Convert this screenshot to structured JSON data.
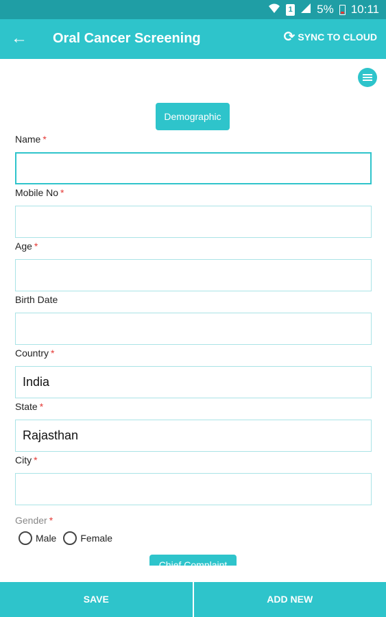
{
  "status_bar": {
    "battery": "5%",
    "time": "10:11",
    "sim_label": "1"
  },
  "app_bar": {
    "title": "Oral Cancer Screening",
    "sync_label": "SYNC TO CLOUD"
  },
  "section": {
    "current": "Demographic",
    "next": "Chief Complaint"
  },
  "form": {
    "fields": [
      {
        "label": "Name",
        "required": "*",
        "value": ""
      },
      {
        "label": "Mobile No",
        "required": "*",
        "value": ""
      },
      {
        "label": "Age",
        "required": "*",
        "value": ""
      },
      {
        "label": "Birth Date",
        "required": "",
        "value": ""
      },
      {
        "label": "Country",
        "required": "*",
        "value": "India"
      },
      {
        "label": "State",
        "required": "*",
        "value": "Rajasthan"
      },
      {
        "label": "City",
        "required": "*",
        "value": ""
      }
    ],
    "gender": {
      "label": "Gender",
      "required": "*",
      "options": [
        "Male",
        "Female"
      ]
    }
  },
  "bottom_bar": {
    "save_label": "SAVE",
    "add_new_label": "ADD NEW"
  },
  "colors": {
    "accent": "#2ec4cb",
    "status_bar": "#1f9ea5",
    "required": "#e53935"
  }
}
